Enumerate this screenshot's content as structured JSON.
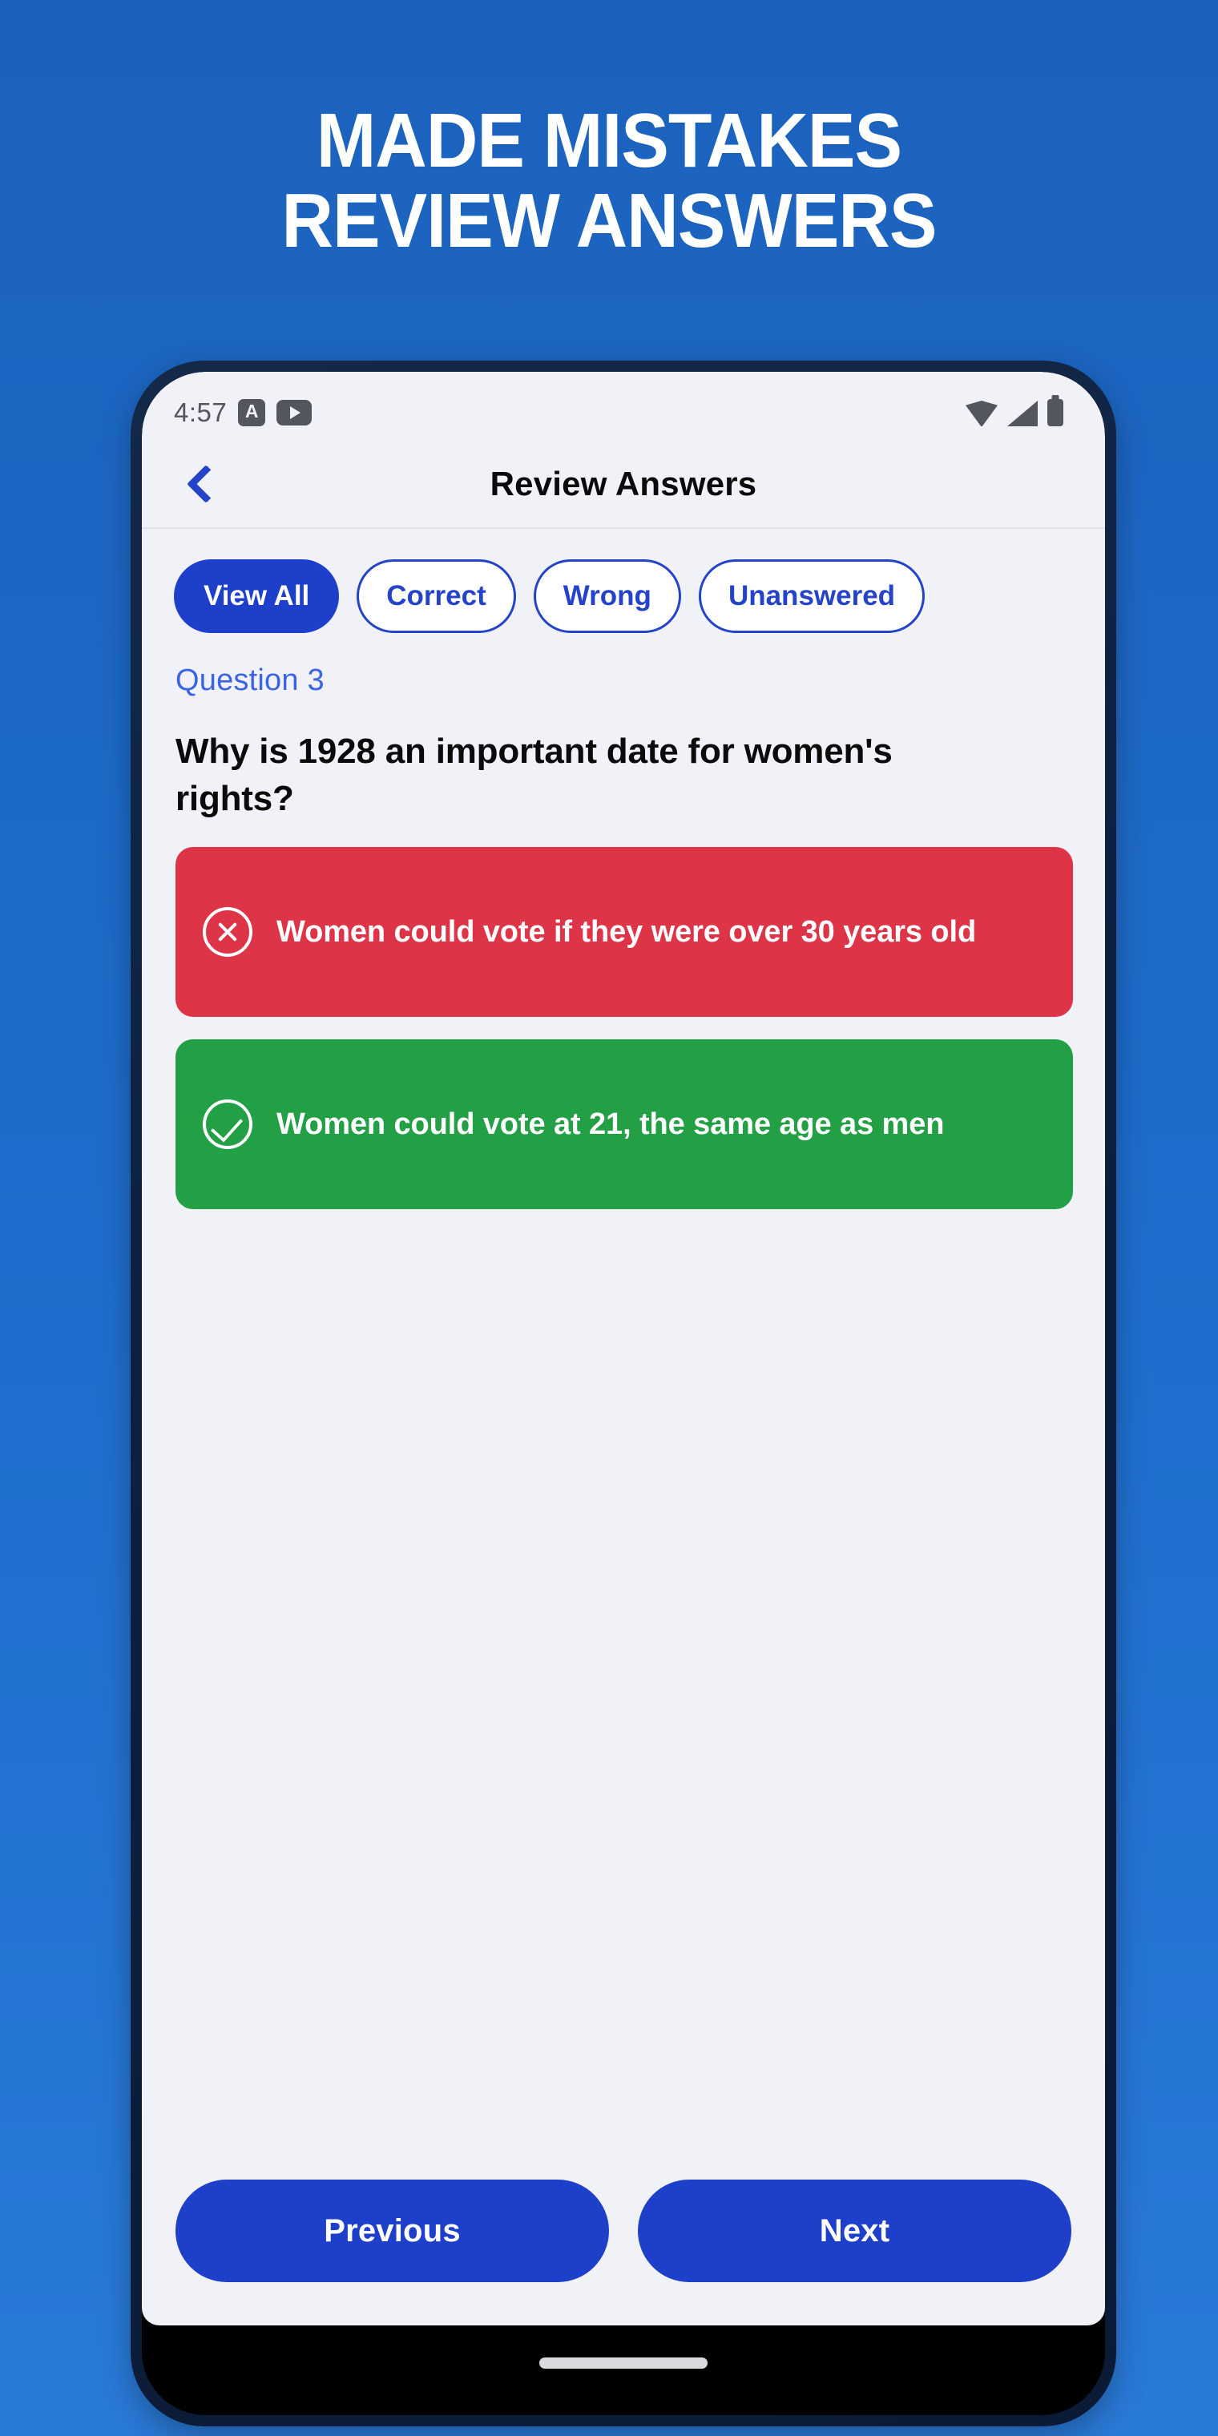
{
  "promo": {
    "headline_line1": "MADE MISTAKES",
    "headline_line2": "REVIEW ANSWERS",
    "background_color": "#1a63c0",
    "text_color": "#ffffff"
  },
  "status_bar": {
    "time": "4:57",
    "left_icons": [
      "accessibility-a-icon",
      "video-play-icon"
    ],
    "right_icons": [
      "wifi-icon",
      "cellular-signal-icon",
      "battery-icon"
    ],
    "icon_color": "#53565e"
  },
  "app_bar": {
    "back_icon": "chevron-left-icon",
    "title": "Review Answers",
    "accent_color": "#2443c9"
  },
  "filters": {
    "selected": "View All",
    "chips": [
      {
        "label": "View All",
        "selected": true
      },
      {
        "label": "Correct",
        "selected": false
      },
      {
        "label": "Wrong",
        "selected": false
      },
      {
        "label": "Unanswered",
        "selected": false
      }
    ]
  },
  "question": {
    "index_label": "Question 3",
    "text": "Why is 1928 an important date for women's rights?"
  },
  "answers": [
    {
      "text": "Women could vote if they were over 30 years old",
      "state": "wrong",
      "icon": "circle-x-icon",
      "color": "#dd3448"
    },
    {
      "text": "Women could vote at 21, the same age as men",
      "state": "correct",
      "icon": "circle-check-icon",
      "color": "#23a045"
    }
  ],
  "bottom_nav": {
    "previous_label": "Previous",
    "next_label": "Next",
    "button_color": "#1e3fc9"
  },
  "system_nav": {
    "home_indicator": "home-pill-indicator"
  }
}
